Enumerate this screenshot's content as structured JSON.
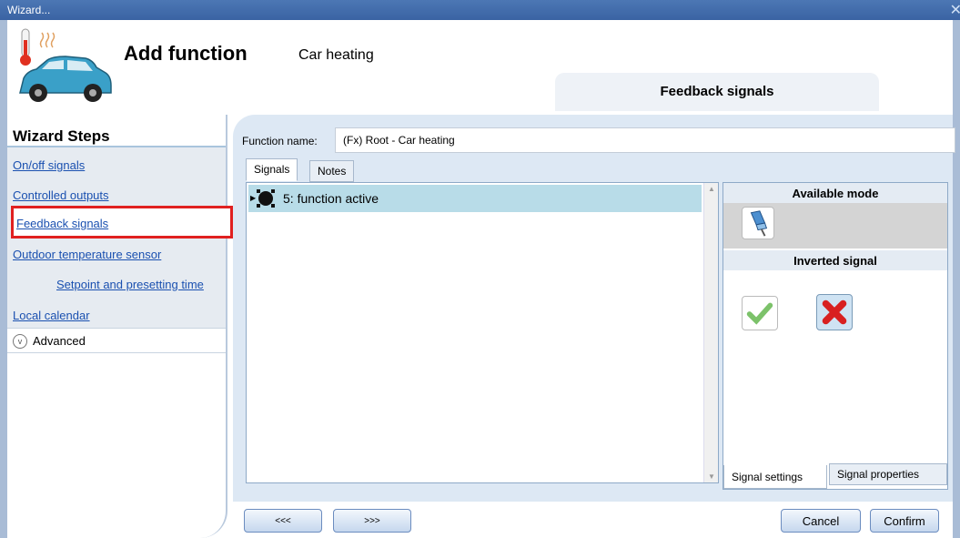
{
  "window": {
    "title": "Wizard...",
    "close_glyph": "✕"
  },
  "header": {
    "heading": "Add function",
    "function_type": "Car heating",
    "current_step": "Feedback signals"
  },
  "sidebar": {
    "title": "Wizard Steps",
    "items": [
      {
        "label": "On/off signals"
      },
      {
        "label": "Controlled outputs"
      },
      {
        "label": "Feedback signals"
      },
      {
        "label": "Outdoor temperature sensor"
      },
      {
        "label": "Setpoint and presetting time"
      },
      {
        "label": "Local calendar"
      }
    ],
    "advanced_label": "Advanced"
  },
  "main": {
    "function_name_label": "Function name:",
    "function_name_value": "(Fx) Root - Car heating",
    "tabs": [
      {
        "label": "Signals"
      },
      {
        "label": "Notes"
      }
    ],
    "signals": [
      {
        "label": "5: function active"
      }
    ]
  },
  "settings": {
    "available_mode_title": "Available mode",
    "inverted_signal_title": "Inverted signal",
    "bottom_tabs": [
      {
        "label": "Signal settings"
      },
      {
        "label": "Signal properties"
      }
    ]
  },
  "footer": {
    "prev_label": "<<<",
    "next_label": ">>>",
    "cancel_label": "Cancel",
    "confirm_label": "Confirm"
  },
  "colors": {
    "accent": "#3a63a3",
    "selection": "#b8dce8",
    "highlight_border": "#e02020"
  }
}
